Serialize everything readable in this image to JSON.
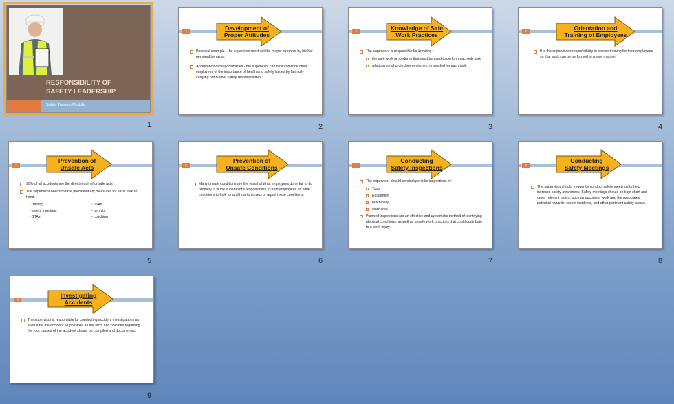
{
  "slides": [
    {
      "number": "1",
      "title": "RESPONSIBILITY OF\nSAFETY LEADERSHIP",
      "subtitle": "Safety Training Module"
    },
    {
      "number": "2",
      "badge": "2",
      "title": "Development of\nProper Attitudes",
      "bullets": [
        "Personal example - the supervisor must set the proper example by his/her personal behavior.",
        "Acceptance of responsibilities - the supervisor can best convince other employees of the importance of health and safety issues by faithfully carrying out his/her safety responsibilities."
      ]
    },
    {
      "number": "3",
      "badge": "3",
      "title": "Knowledge of Safe\nWork Practices",
      "bullets": [
        "The supervisor is responsible for knowing:"
      ],
      "subbullets": [
        "the safe work procedures that must be used to perform each job task.",
        "what personal protective equipment is needed for each task."
      ]
    },
    {
      "number": "4",
      "badge": "4",
      "title": "Orientation and\nTraining of Employees",
      "bullets": [
        "It is the supervisor's responsibility to ensure training for their employees so that work can be performed in a safe manner."
      ]
    },
    {
      "number": "5",
      "badge": "5",
      "title": "Prevention of\nUnsafe Acts",
      "bullets": [
        "90% of all accidents are the direct result of unsafe acts.",
        "The supervisor needs to take precautionary measures for each task at hand."
      ],
      "col_left": [
        "- training",
        "- safety meetings",
        "- STAs"
      ],
      "col_right": [
        "- JSAs",
        "- permits",
        "- coaching"
      ]
    },
    {
      "number": "6",
      "badge": "6",
      "title": "Prevention of\nUnsafe Conditions",
      "bullets": [
        "Many unsafe conditions are the result of what employees do or fail to do properly.  It is the supervisor's responsibility to train employees  on what conditions to look for and how to correct or report those conditions."
      ]
    },
    {
      "number": "7",
      "badge": "7",
      "title": "Conducting\nSafety Inspections",
      "bullets": [
        "The supervisor should conduct periodic inspections of:"
      ],
      "subbullets": [
        "Tools",
        "Equipment",
        "Machinery",
        "work area"
      ],
      "bullets_after": [
        "Planned inspections are an effective and systematic method of identifying physical conditions, as well as unsafe work practices that could contribute to a work injury."
      ]
    },
    {
      "number": "8",
      "badge": "8",
      "title": "Conducting\nSafety Meetings",
      "bullets": [
        "The supervisor should frequently conduct safety meetings to help increase safety awareness. Safety meetings should be kept short and cover relevant topics, such as upcoming work and the associated potential hazards, recent incidents, and other pertinent safety issues."
      ]
    },
    {
      "number": "9",
      "badge": "9",
      "title": "Investigating\nAccidents",
      "bullets": [
        "The supervisor is responsible  for conducting accident investigations as soon after the accident as possible.  All the facts and opinions regarding the root causes of the accident  should be compiled and documented."
      ]
    }
  ],
  "colors": {
    "arrow_fill": "#f7b11c",
    "arrow_stroke": "#7a5a10",
    "title_brown": "#7c6456",
    "accent_orange": "#e27b42",
    "bar_blue": "#a9c1d7"
  }
}
